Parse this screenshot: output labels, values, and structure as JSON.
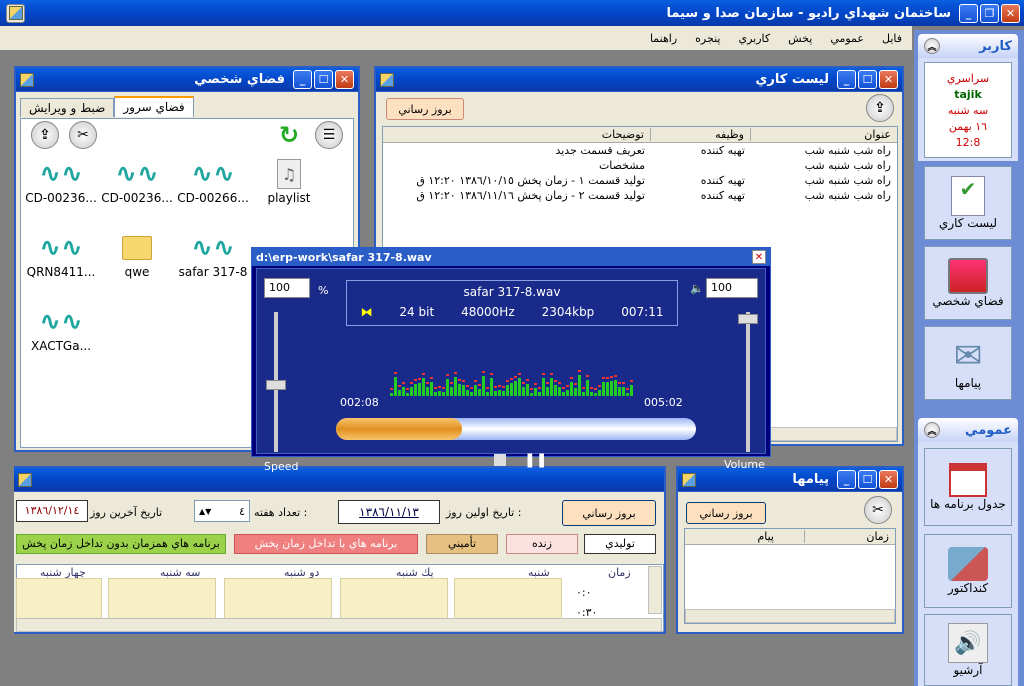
{
  "app": {
    "title": "ساختمان شهداي راديو - سازمان صدا و سيما"
  },
  "menu": [
    "فايل",
    "عمومي",
    "پخش",
    "كاربري",
    "پنجره",
    "راهنما"
  ],
  "user": {
    "header": "كاربر",
    "name1": "سراسري",
    "name2": "tajik",
    "day": "سه شنبه",
    "date": "١٦ بهمن",
    "time": "12:8"
  },
  "side": {
    "btn1": "ليست كاري",
    "btn2": "فضاي شخصي",
    "btn3": "پيامها",
    "general": "عمومي",
    "btn4": "جدول برنامه ها",
    "btn5": "كنداكتور",
    "btn6": "آرشيو"
  },
  "personal": {
    "title": "فضاي شخصي",
    "tab1": "فضاي سرور",
    "tab2": "ضبط و ويرايش",
    "files": [
      "CD-00236...",
      "CD-00236...",
      "CD-00266...",
      "playlist",
      "QRN8411...",
      "qwe",
      "safar 317-8",
      "XACTGa..."
    ]
  },
  "worklist": {
    "title": "ليست كاري",
    "refresh": "بروز رساني",
    "headers": [
      "عنوان",
      "وظيفه",
      "توضيحات"
    ],
    "rows": [
      [
        "راه شب شنبه شب",
        "تهيه كننده",
        "تعريف قسمت جديد"
      ],
      [
        "راه شب شنبه شب",
        "",
        "مشخصات"
      ],
      [
        "راه شب شنبه شب",
        "تهيه كننده",
        "توليد قسمت ١ - زمان پخش  ١٣٨٦/١٠/١٥  ١٢:٢٠ ق"
      ],
      [
        "راه شب شنبه شب",
        "تهيه كننده",
        "توليد قسمت ٢ - زمان پخش  ١٣٨٦/١١/١٦  ١٢:٢٠ ق"
      ]
    ]
  },
  "player": {
    "title": "d:\\erp-work\\safar 317-8.wav",
    "speed_value": "100",
    "pct": "%",
    "volume_value": "100",
    "filename": "safar 317-8.wav",
    "bits": "24 bit",
    "rate": "48000Hz",
    "kbps": "2304kbp",
    "length": "007:11",
    "elapsed": "002:08",
    "remain": "005:02",
    "speed_label": "Speed",
    "volume_label": "Volume",
    "progress": 0.35
  },
  "schedule": {
    "last_day_label": "تاريخ آخرين روز",
    "last_day": "١٣٨٦/١٢/١٤",
    "weeks_label": "تعداد هفته :",
    "weeks": "٤",
    "first_day_label": "تاريخ اولين روز :",
    "first_day": "١٣٨٦/١١/١٣",
    "refresh": "بروز رساني",
    "legend": [
      "توليدي",
      "زنده",
      "تأميني",
      "برنامه هاي با تداخل زمان پخش",
      "برنامه هاي همزمان بدون تداخل زمان پخش"
    ],
    "days": [
      "زمان",
      "شنبه",
      "يك شنبه",
      "دو شنبه",
      "سه شنبه",
      "چهار شنبه"
    ],
    "times": [
      "٠:٠",
      "٠:٣٠"
    ]
  },
  "messages": {
    "title": "پيامها",
    "refresh": "بروز رساني",
    "col_time": "زمان",
    "col_msg": "پيام"
  }
}
